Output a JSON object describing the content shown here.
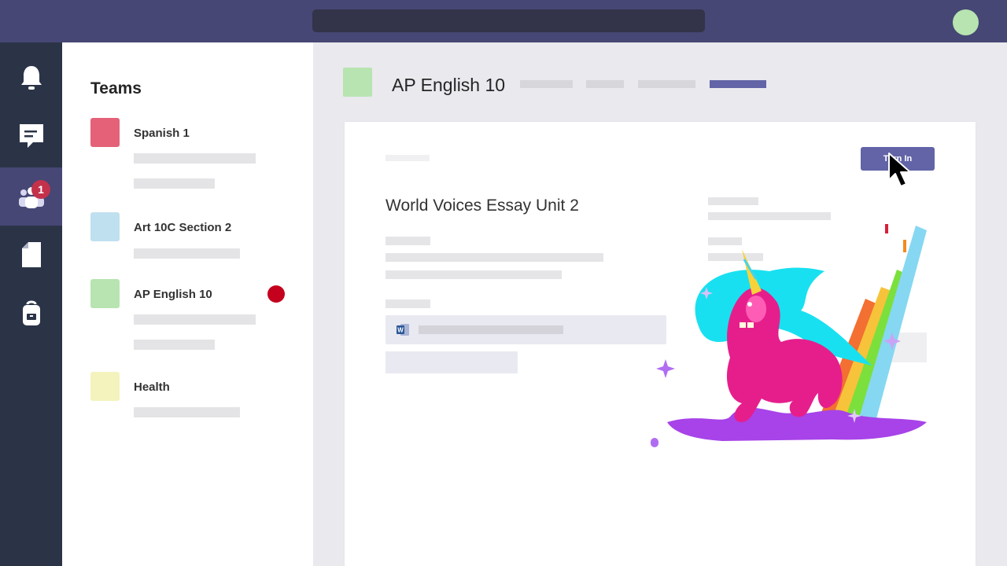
{
  "teams_panel": {
    "title": "Teams",
    "items": [
      {
        "name": "Spanish 1",
        "color": "#e46177"
      },
      {
        "name": "Art 10C Section 2",
        "color": "#bfe0ef"
      },
      {
        "name": "AP English 10",
        "color": "#b7e4b0"
      },
      {
        "name": "Health",
        "color": "#f4f3bd"
      }
    ]
  },
  "rail": {
    "items": [
      "bell-icon",
      "chat-icon",
      "teams-icon",
      "files-icon",
      "backpack-icon"
    ],
    "teams_badge": "1"
  },
  "channel": {
    "title": "AP English 10",
    "color": "#b7e4b0"
  },
  "assignment": {
    "title": "World Voices Essay Unit 2",
    "turn_in_label": "Turn In",
    "attachment_icon": "word-icon"
  },
  "colors": {
    "topbar": "#464775",
    "rail": "#2b3447",
    "accent": "#6264a7",
    "notification_dot": "#c4001e"
  }
}
